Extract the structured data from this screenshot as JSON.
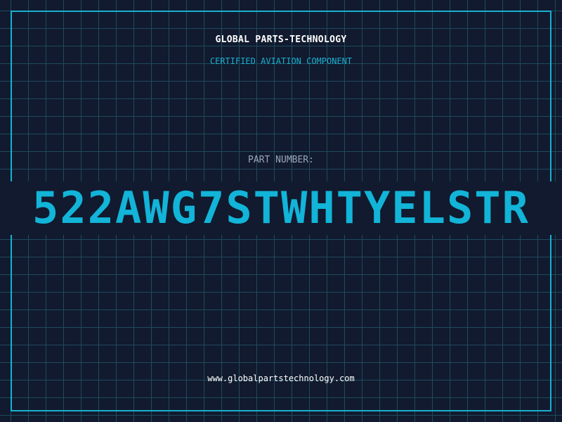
{
  "header": {
    "company_name": "GLOBAL PARTS-TECHNOLOGY",
    "subtitle": "CERTIFIED AVIATION COMPONENT"
  },
  "part": {
    "label": "PART NUMBER:",
    "number": "522AWG7STWHTYELSTR"
  },
  "footer": {
    "website": "www.globalpartstechnology.com"
  },
  "colors": {
    "background": "#111a2e",
    "grid": "#1f4a5e",
    "accent": "#12b4d8",
    "label": "#9aa8b8",
    "text": "#ffffff"
  }
}
